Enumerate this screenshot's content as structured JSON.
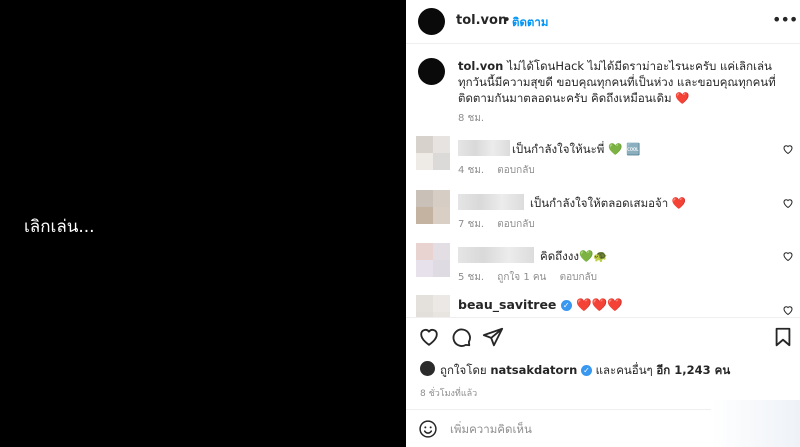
{
  "media": {
    "text": "เลิกเล่น..."
  },
  "header": {
    "username": "tol.von",
    "separator": "•",
    "follow_label": "ติดตาม",
    "more_icon": "more-icon"
  },
  "caption": {
    "username": "tol.von",
    "text": "ไม่ได้โดนHack ไม่ได้มีดราม่าอะไรนะครับ แค่เลิกเล่น ทุกวันนี้มีความสุขดี ขอบคุณทุกคนที่เป็นห่วง และขอบคุณทุกคนที่ติดตามกันมาตลอดนะครับ คิดถึงเหมือนเดิม ❤️",
    "time": "8 ชม."
  },
  "comments": [
    {
      "text": "เป็นกำลังใจให้นะพี่ 💚 🆒",
      "time": "4 ชม.",
      "likes": "",
      "reply": "ตอบกลับ"
    },
    {
      "text": "เป็นกำลังใจให้ตลอดเสมอจ้า ❤️",
      "time": "7 ชม.",
      "likes": "",
      "reply": "ตอบกลับ"
    },
    {
      "text": "คิดถึงงง💚🐢",
      "time": "5 ชม.",
      "likes": "ถูกใจ 1 คน",
      "reply": "ตอบกลับ"
    },
    {
      "username": "beau_savitree",
      "text": "❤️❤️❤️"
    }
  ],
  "likes": {
    "prefix": "ถูกใจโดย",
    "user": "natsakdatorn",
    "middle": "และคนอื่นๆ",
    "count": "อีก 1,243 คน"
  },
  "posted": "8 ชั่วโมงที่แล้ว",
  "add_comment": {
    "placeholder": "เพิ่มความคิดเห็น"
  },
  "colors": {
    "accent": "#0095f6",
    "heart_red": "#ed4956",
    "text": "#262626",
    "muted": "#8e8e8e"
  }
}
